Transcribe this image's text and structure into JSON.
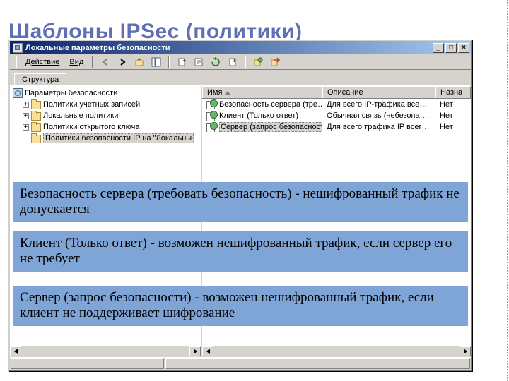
{
  "slide_title": "Шаблоны IPSec (политики)",
  "window": {
    "title": "Локальные параметры безопасности",
    "min": "_",
    "max": "□",
    "close": "×"
  },
  "menu": {
    "action": "Действие",
    "view": "Вид"
  },
  "tab": "Структура",
  "tree": {
    "root": "Параметры безопасности",
    "nodes": [
      "Политики учетных записей",
      "Локальные политики",
      "Политики открытого ключа",
      "Политики безопасности IP на \"Локальны"
    ]
  },
  "list": {
    "headers": {
      "name": "Имя",
      "desc": "Описание",
      "assigned": "Назна"
    },
    "rows": [
      {
        "name": "Безопасность сервера (тре…",
        "desc": "Для всего IP-трафика все…",
        "assigned": "Нет"
      },
      {
        "name": "Клиент (Только ответ)",
        "desc": "Обычная связь (небезопас…",
        "assigned": "Нет"
      },
      {
        "name": "Сервер (запрос безопасности)",
        "desc": "Для всего трафика IP всег…",
        "assigned": "Нет"
      }
    ]
  },
  "explain": {
    "e1": "Безопасность сервера (требовать безопасность) - нешифрованный трафик не допускается",
    "e2": "Клиент (Только ответ) - возможен нешифрованный трафик, если сервер его не требует",
    "e3": "Сервер (запрос безопасности) - возможен нешифрованный трафик, если клиент не поддерживает шифрование"
  }
}
